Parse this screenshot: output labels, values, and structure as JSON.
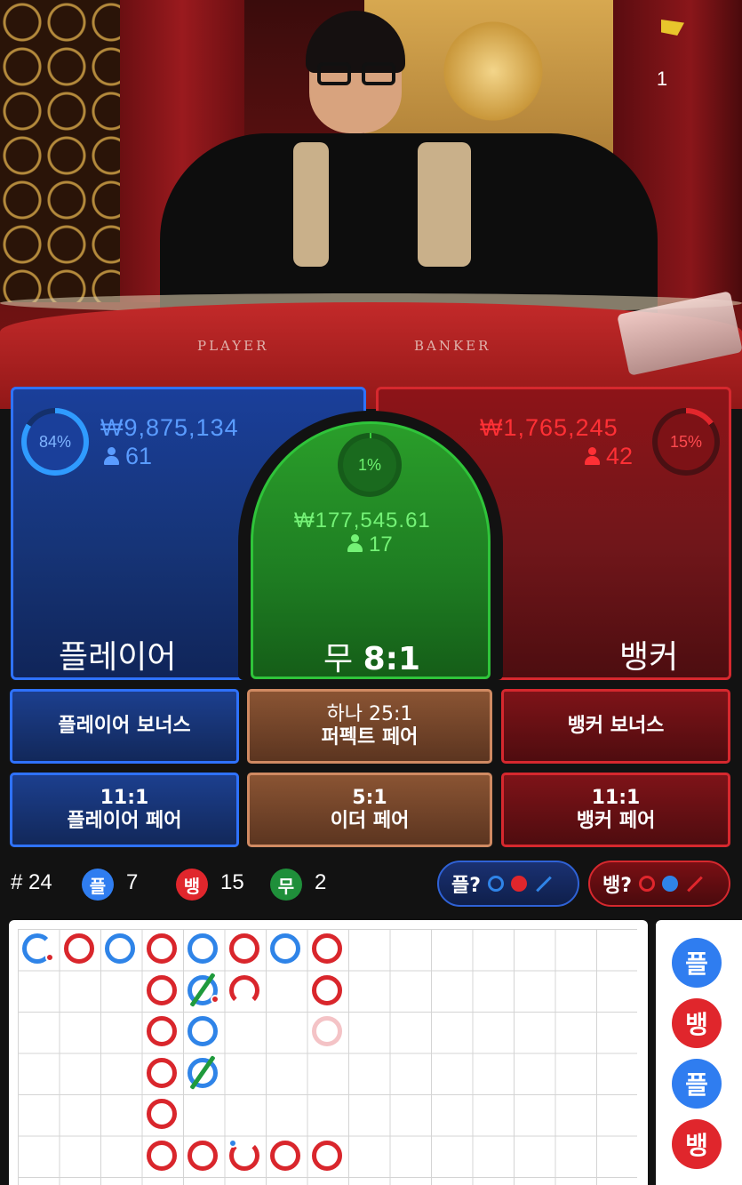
{
  "video": {
    "round_number": "1",
    "table_labels": {
      "player": "PLAYER",
      "banker": "BANKER"
    }
  },
  "bets": {
    "player": {
      "percent": "84%",
      "percent_value": 84,
      "amount": "₩9,875,134",
      "players": "61",
      "label": "플레이어"
    },
    "tie": {
      "percent": "1%",
      "percent_value": 1,
      "amount": "₩177,545.61",
      "players": "17",
      "label": "무",
      "payout": "8:1"
    },
    "banker": {
      "percent": "15%",
      "percent_value": 15,
      "amount": "₩1,765,245",
      "players": "42",
      "label": "뱅커"
    }
  },
  "side_bets": {
    "player_bonus": {
      "label": "플레이어 보너스"
    },
    "perfect_pair": {
      "odds": "하나 25:1",
      "label": "퍼펙트 페어"
    },
    "banker_bonus": {
      "label": "뱅커 보너스"
    },
    "player_pair": {
      "odds": "11:1",
      "label": "플레이어 페어"
    },
    "either_pair": {
      "odds": "5:1",
      "label": "이더 페어"
    },
    "banker_pair": {
      "odds": "11:1",
      "label": "뱅커 페어"
    }
  },
  "stats": {
    "rounds": "# 24",
    "player_badge": "플",
    "player_count": "7",
    "banker_badge": "뱅",
    "banker_count": "15",
    "tie_badge": "무",
    "tie_count": "2"
  },
  "ask": {
    "player": "플?",
    "banker": "뱅?"
  },
  "side_road": {
    "items": [
      "플",
      "뱅",
      "플",
      "뱅"
    ]
  },
  "colors": {
    "player": "#2f72ff",
    "banker": "#d6282e",
    "tie": "#2fc43a",
    "side_brown": "#8a5433"
  }
}
